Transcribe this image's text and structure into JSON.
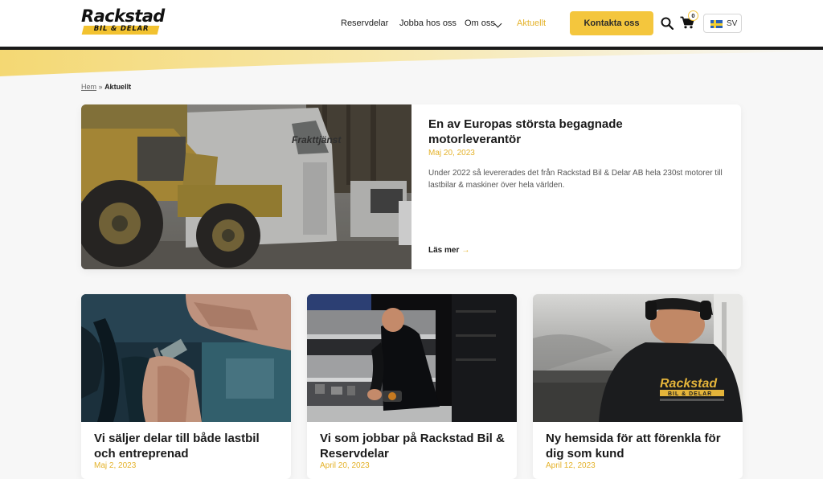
{
  "brand": {
    "name": "Rackstad",
    "tagline": "BIL & DELAR"
  },
  "nav": {
    "items": [
      "Reservdelar",
      "Jobba hos oss",
      "Om oss",
      "Aktuellt"
    ],
    "cta": "Kontakta oss",
    "cart_count": "0",
    "language": "SV"
  },
  "breadcrumb": {
    "home": "Hem",
    "sep": "»",
    "current": "Aktuellt"
  },
  "featured": {
    "title": "En av Europas största begagnade motorleverantör",
    "date": "Maj 20, 2023",
    "excerpt": "Under 2022 så levererades det från Rackstad Bil & Delar AB hela 230st motorer till lastbilar & maskiner över hela världen.",
    "read_more": "Läs mer",
    "image_text": {
      "truck_side": "Frakttjänst"
    }
  },
  "cards": [
    {
      "title": "Vi säljer delar till både lastbil och entreprenad",
      "date": "Maj 2, 2023"
    },
    {
      "title": "Vi som jobbar på Rackstad Bil & Reservdelar",
      "date": "April 20, 2023"
    },
    {
      "title": "Ny hemsida för att förenkla för dig som kund",
      "date": "April 12, 2023",
      "image_text": {
        "jacket_brand": "Rackstad",
        "jacket_tagline": "BIL & DELAR"
      }
    }
  ],
  "colors": {
    "accent": "#f4c63d",
    "accent_text": "#e4b22a",
    "dark": "#1a1a1a",
    "background": "#f7f7f7"
  },
  "icons": [
    "search-icon",
    "cart-icon",
    "chevron-down-icon",
    "arrow-right-icon",
    "flag-se-icon"
  ]
}
